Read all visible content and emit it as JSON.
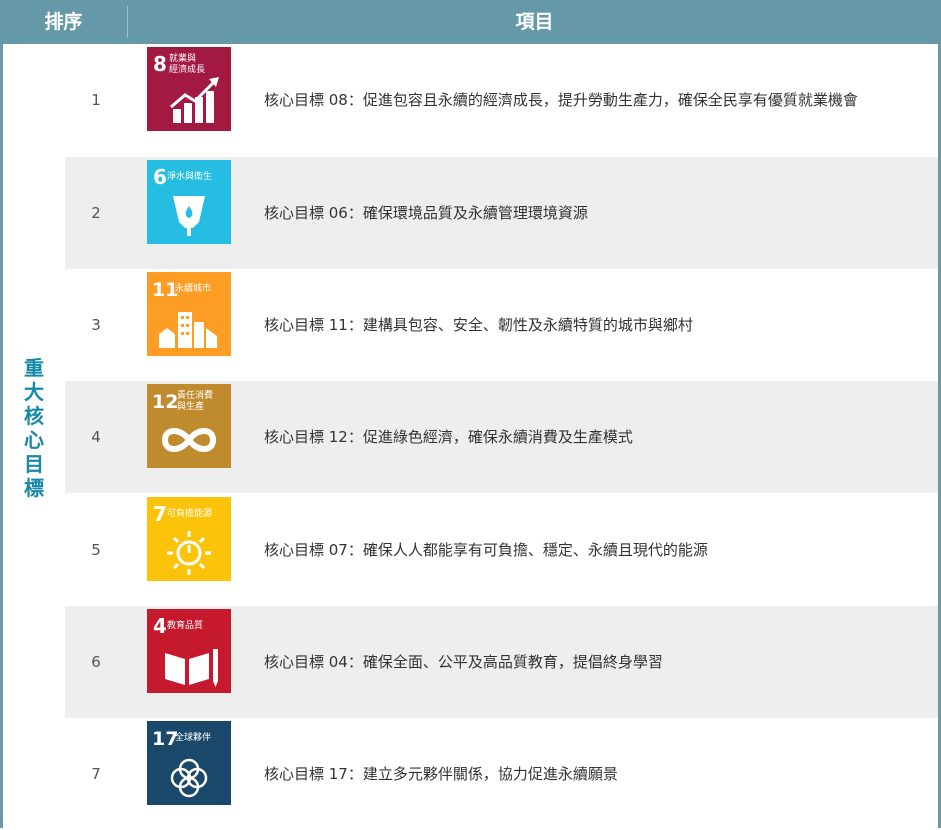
{
  "header": {
    "rank_label": "排序",
    "item_label": "項目"
  },
  "group_label": "重大核心目標",
  "colors": {
    "header": "#6699a8",
    "group_text": "#1788a8"
  },
  "rows": [
    {
      "rank": "1",
      "goal_num": "8",
      "goal_title_line1": "就業與",
      "goal_title_line2": "經濟成長",
      "icon": "growth-chart-icon",
      "color": "#a21942",
      "text": "核心目標 08：促進包容且永續的經濟成長，提升勞動生產力，確保全民享有優質就業機會"
    },
    {
      "rank": "2",
      "goal_num": "6",
      "goal_title_line1": "淨水與衛生",
      "goal_title_line2": "",
      "icon": "water-glass-icon",
      "color": "#26bde2",
      "text": "核心目標 06：確保環境品質及永續管理環境資源"
    },
    {
      "rank": "3",
      "goal_num": "11",
      "goal_title_line1": "永續城市",
      "goal_title_line2": "",
      "icon": "city-buildings-icon",
      "color": "#fd9d24",
      "text": "核心目標 11：建構具包容、安全、韌性及永續特質的城市與鄉村"
    },
    {
      "rank": "4",
      "goal_num": "12",
      "goal_title_line1": "責任消費",
      "goal_title_line2": "與生產",
      "icon": "infinity-loop-icon",
      "color": "#bf8b2e",
      "text": "核心目標 12：促進綠色經濟，確保永續消費及生產模式"
    },
    {
      "rank": "5",
      "goal_num": "7",
      "goal_title_line1": "可負擔能源",
      "goal_title_line2": "",
      "icon": "sun-power-icon",
      "color": "#fcc30b",
      "text": "核心目標 07：確保人人都能享有可負擔、穩定、永續且現代的能源"
    },
    {
      "rank": "6",
      "goal_num": "4",
      "goal_title_line1": "教育品質",
      "goal_title_line2": "",
      "icon": "book-pencil-icon",
      "color": "#c5192d",
      "text": "核心目標 04：確保全面、公平及高品質教育，提倡終身學習"
    },
    {
      "rank": "7",
      "goal_num": "17",
      "goal_title_line1": "全球夥伴",
      "goal_title_line2": "",
      "icon": "flower-rings-icon",
      "color": "#19486a",
      "text": "核心目標 17：建立多元夥伴關係，協力促進永續願景"
    }
  ]
}
